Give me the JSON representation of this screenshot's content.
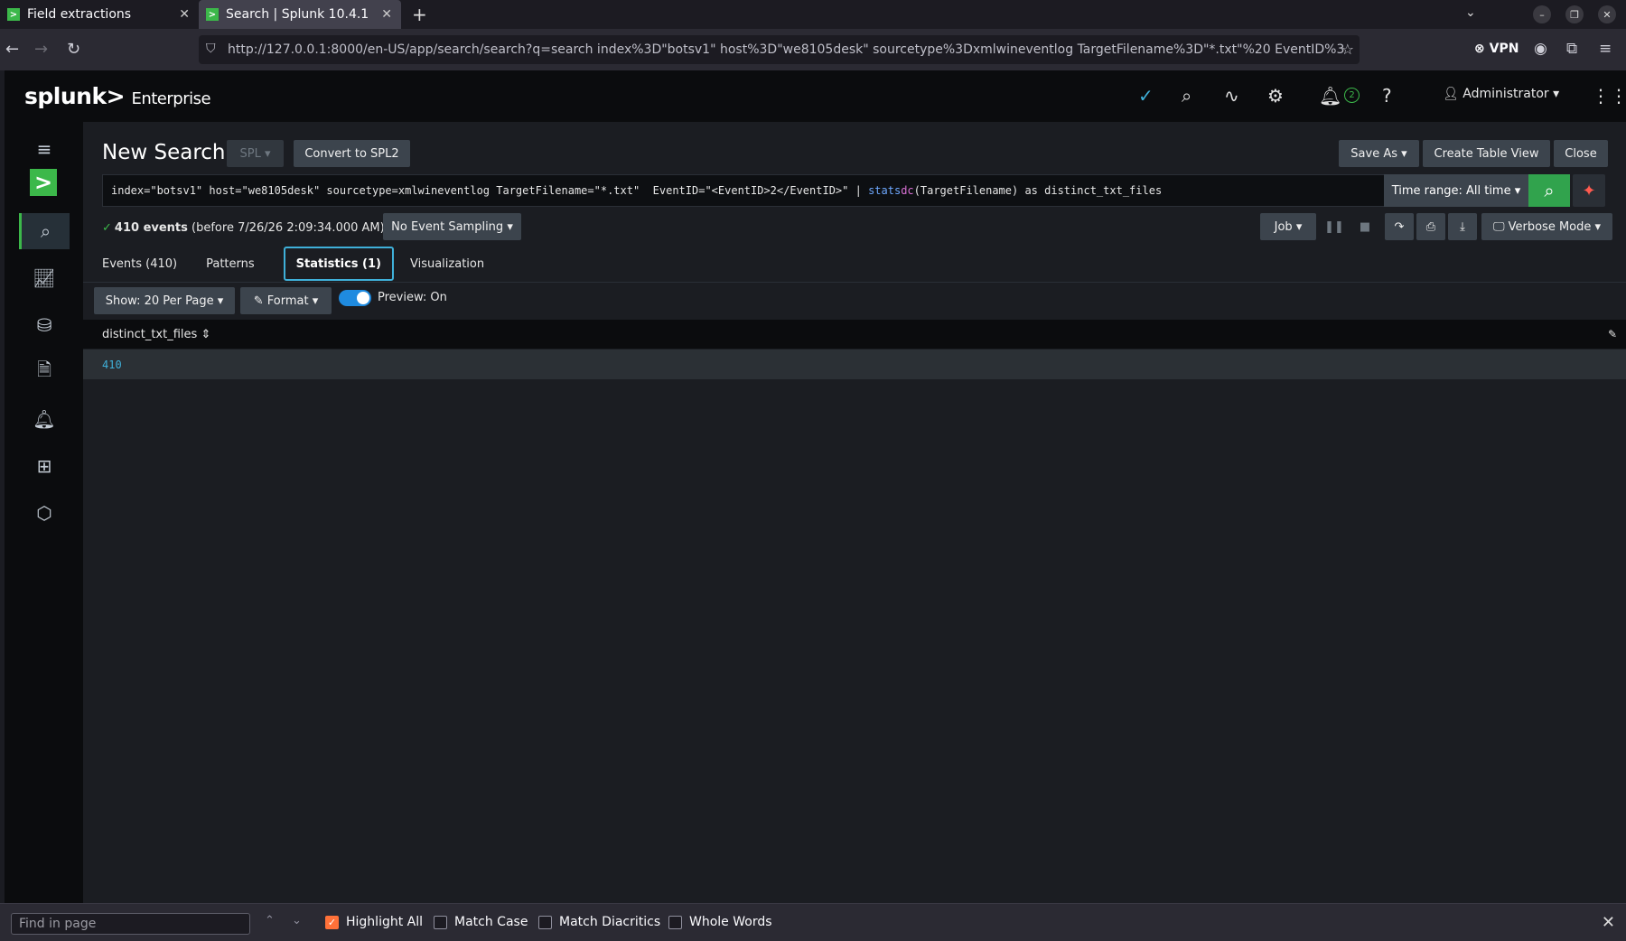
{
  "browser": {
    "tabs": [
      {
        "label": "Field extractions"
      },
      {
        "label": "Search | Splunk 10.4.1"
      }
    ],
    "url": "http://127.0.0.1:8000/en-US/app/search/search?q=search index%3D\"botsv1\" host%3D\"we8105desk\" sourcetype%3Dxmlwineventlog TargetFilename%3D\"*.txt\"%20 EventID%3",
    "vpn": "VPN"
  },
  "header": {
    "logo_main": "splunk>",
    "logo_sub": "Enterprise",
    "notifications": "2",
    "user": "Administrator"
  },
  "search": {
    "title": "New Search",
    "lang": "SPL",
    "convert_label": "Convert to SPL2",
    "save_as": "Save As",
    "create_table": "Create Table View",
    "close": "Close",
    "query_part1": "index=\"botsv1\" host=\"we8105desk\" sourcetype=xmlwineventlog TargetFilename=\"*.txt\"  EventID=\"<EventID>2</EventID>\" | ",
    "query_kw": "stats",
    "query_fn": "dc",
    "query_part2": "(TargetFilename) as distinct_txt_files",
    "time_range": "Time range: All time",
    "events_count": "410 events",
    "events_time": "(before 7/26/26 2:09:34.000 AM)",
    "sampling": "No Event Sampling",
    "job": "Job",
    "mode": "Verbose Mode"
  },
  "tabs": [
    {
      "label": "Events (410)"
    },
    {
      "label": "Patterns"
    },
    {
      "label": "Statistics (1)"
    },
    {
      "label": "Visualization"
    }
  ],
  "toolbar": {
    "per_page": "Show: 20 Per Page",
    "format": "Format",
    "preview": "Preview: On"
  },
  "table": {
    "column": "distinct_txt_files",
    "rows": [
      {
        "value": "410"
      }
    ]
  },
  "findbar": {
    "placeholder": "Find in page",
    "highlight": "Highlight All",
    "match_case": "Match Case",
    "diacritics": "Match Diacritics",
    "whole": "Whole Words"
  }
}
